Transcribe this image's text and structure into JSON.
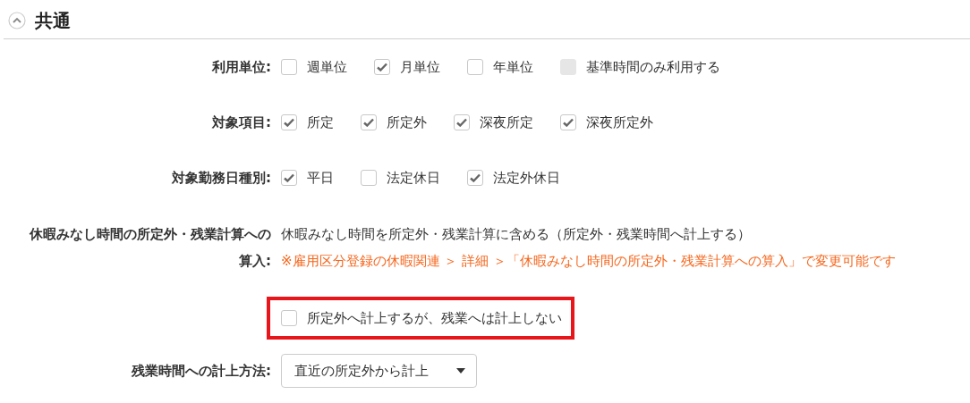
{
  "section": {
    "title": "共通",
    "expanded": true
  },
  "rows": [
    {
      "kind": "checkboxes",
      "label": "利用単位:",
      "options": [
        {
          "label": "週単位",
          "checked": false,
          "disabled": false
        },
        {
          "label": "月単位",
          "checked": true,
          "disabled": false
        },
        {
          "label": "年単位",
          "checked": false,
          "disabled": false
        },
        {
          "label": "基準時間のみ利用する",
          "checked": false,
          "disabled": true
        }
      ]
    },
    {
      "kind": "checkboxes",
      "label": "対象項目:",
      "options": [
        {
          "label": "所定",
          "checked": true,
          "disabled": false
        },
        {
          "label": "所定外",
          "checked": true,
          "disabled": false
        },
        {
          "label": "深夜所定",
          "checked": true,
          "disabled": false
        },
        {
          "label": "深夜所定外",
          "checked": true,
          "disabled": false
        }
      ]
    },
    {
      "kind": "checkboxes",
      "label": "対象勤務日種別:",
      "options": [
        {
          "label": "平日",
          "checked": true,
          "disabled": false
        },
        {
          "label": "法定休日",
          "checked": false,
          "disabled": false
        },
        {
          "label": "法定外休日",
          "checked": true,
          "disabled": false
        }
      ]
    },
    {
      "kind": "note",
      "label": "休暇みなし時間の所定外・残業計算への算入:",
      "text": "休暇みなし時間を所定外・残業計算に含める（所定外・残業時間へ計上する）",
      "note": "※雇用区分登録の休暇関連 ＞ 詳細 ＞「休暇みなし時間の所定外・残業計算への算入」で変更可能です",
      "options": [
        {
          "label": "所定外へ計上するが、残業へは計上しない",
          "checked": false,
          "disabled": false,
          "highlighted": true
        }
      ]
    },
    {
      "kind": "select",
      "label": "残業時間への計上方法:",
      "value": "直近の所定外から計上"
    }
  ]
}
